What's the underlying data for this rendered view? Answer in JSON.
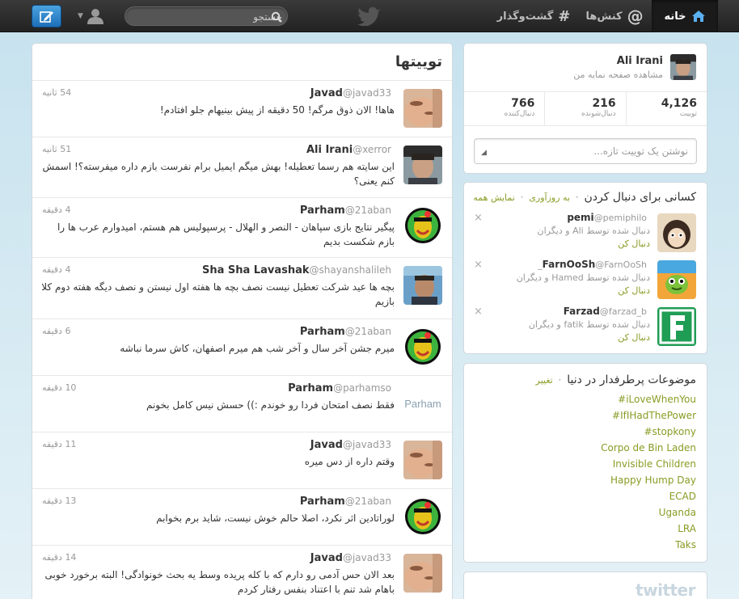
{
  "topbar": {
    "nav": {
      "home": "خانه",
      "connect": "کنش‌ها",
      "discover": "گشت‌وگذار"
    },
    "search_placeholder": "جستجو"
  },
  "timeline": {
    "title": "توییتها",
    "tweets": [
      {
        "name": "Javad",
        "handle": "@javad33",
        "time": "54 ثانیه",
        "text": "هاها! الان ذوق مرگم! 50 دقیقه از پیش بینیهام جلو افتادم!",
        "avatar": "javad"
      },
      {
        "name": "Ali Irani",
        "handle": "@xerror",
        "time": "51 ثانیه",
        "text": "این سایته هم رسما تعطیله! بهش میگم ایمیل برام نفرست بازم داره میفرسته؟! اسمش کنم یعنی؟",
        "avatar": "ali"
      },
      {
        "name": "Parham",
        "handle": "@21aban",
        "time": "4 دقیقه",
        "text": "پیگیر نتایج بازی سپاهان - النصر و الهلال - پرسپولیس هم هستم، امیدوارم عرب ها را بازم شکست بدیم",
        "avatar": "parham"
      },
      {
        "name": "Sha Sha Lavashak",
        "handle": "@shayanshalileh",
        "time": "4 دقیقه",
        "text": "بچه ها عید شرکت تعطیل نیست نصف بچه ها هفته اول نیستن و نصف دیگه هفته دوم کلا بازیم",
        "avatar": "shayan"
      },
      {
        "name": "Parham",
        "handle": "@21aban",
        "time": "6 دقیقه",
        "text": "میرم جشن آخر سال و آخر شب هم میرم اصفهان، کاش سرما نباشه",
        "avatar": "parham"
      },
      {
        "name": "Parham",
        "handle": "@parhamso",
        "time": "10 دقیقه",
        "text": "فقط نصف امتحان فردا رو خوندم :)) حسش نیس کامل بخونم",
        "avatar": "parham-text",
        "avatar_text": "Parham"
      },
      {
        "name": "Javad",
        "handle": "@javad33",
        "time": "11 دقیقه",
        "text": "وقتم داره از دس میره",
        "avatar": "javad"
      },
      {
        "name": "Parham",
        "handle": "@21aban",
        "time": "13 دقیقه",
        "text": "لوراتادین اثر نکرد، اصلا حالم خوش نیست، شاید برم بخوابم",
        "avatar": "parham"
      },
      {
        "name": "Javad",
        "handle": "@javad33",
        "time": "14 دقیقه",
        "text": "بعد الان حس آدمی رو دارم که با کله پریده وسط یه بحث خونوادگی! البته برخورد خوبی باهام شد تنم با اعتناد بنفس رفتار کردم",
        "avatar": "javad"
      }
    ]
  },
  "profile": {
    "name": "Ali Irani",
    "view_page": "مشاهده صفحه نمایه من",
    "stats": [
      {
        "num": "4,126",
        "label": "توییت"
      },
      {
        "num": "216",
        "label": "دنبال‌شونده"
      },
      {
        "num": "766",
        "label": "دنبال‌کننده"
      }
    ],
    "new_tweet_placeholder": "نوشتن یک توییت تازه..."
  },
  "who_to_follow": {
    "title": "کسانی برای دنبال کردن",
    "refresh": "به روزآوری",
    "view_all": "نمایش همه",
    "follow_label": "دنبال کن",
    "items": [
      {
        "name": "pemi",
        "handle": "@pemiphilo",
        "via": "دنبال شده توسط Ali و دیگران",
        "avatar": "pemi"
      },
      {
        "name": "FarnOoSh",
        "handle": "@FarnOoSh_",
        "via": "دنبال شده توسط Hamed و دیگران",
        "avatar": "farnoosh"
      },
      {
        "name": "Farzad",
        "handle": "@farzad_b",
        "via": "دنبال شده توسط fatik و دیگران",
        "avatar": "farzad"
      }
    ]
  },
  "trends": {
    "title": "موضوعات پرطرفدار در دنیا",
    "change": "تغییر",
    "items": [
      "#iLoveWhenYou",
      "#IfIHadThePower",
      "#stopkony",
      "Corpo de Bin Laden",
      "Invisible Children",
      "Happy Hump Day",
      "ECAD",
      "Uganda",
      "LRA",
      "Taks"
    ]
  },
  "footer": {
    "logo": "twitter"
  },
  "colors": {
    "accent": "#8b9b24",
    "topbar": "#2b2b2b",
    "compose": "#2b86cf",
    "background": "#c0deed"
  }
}
